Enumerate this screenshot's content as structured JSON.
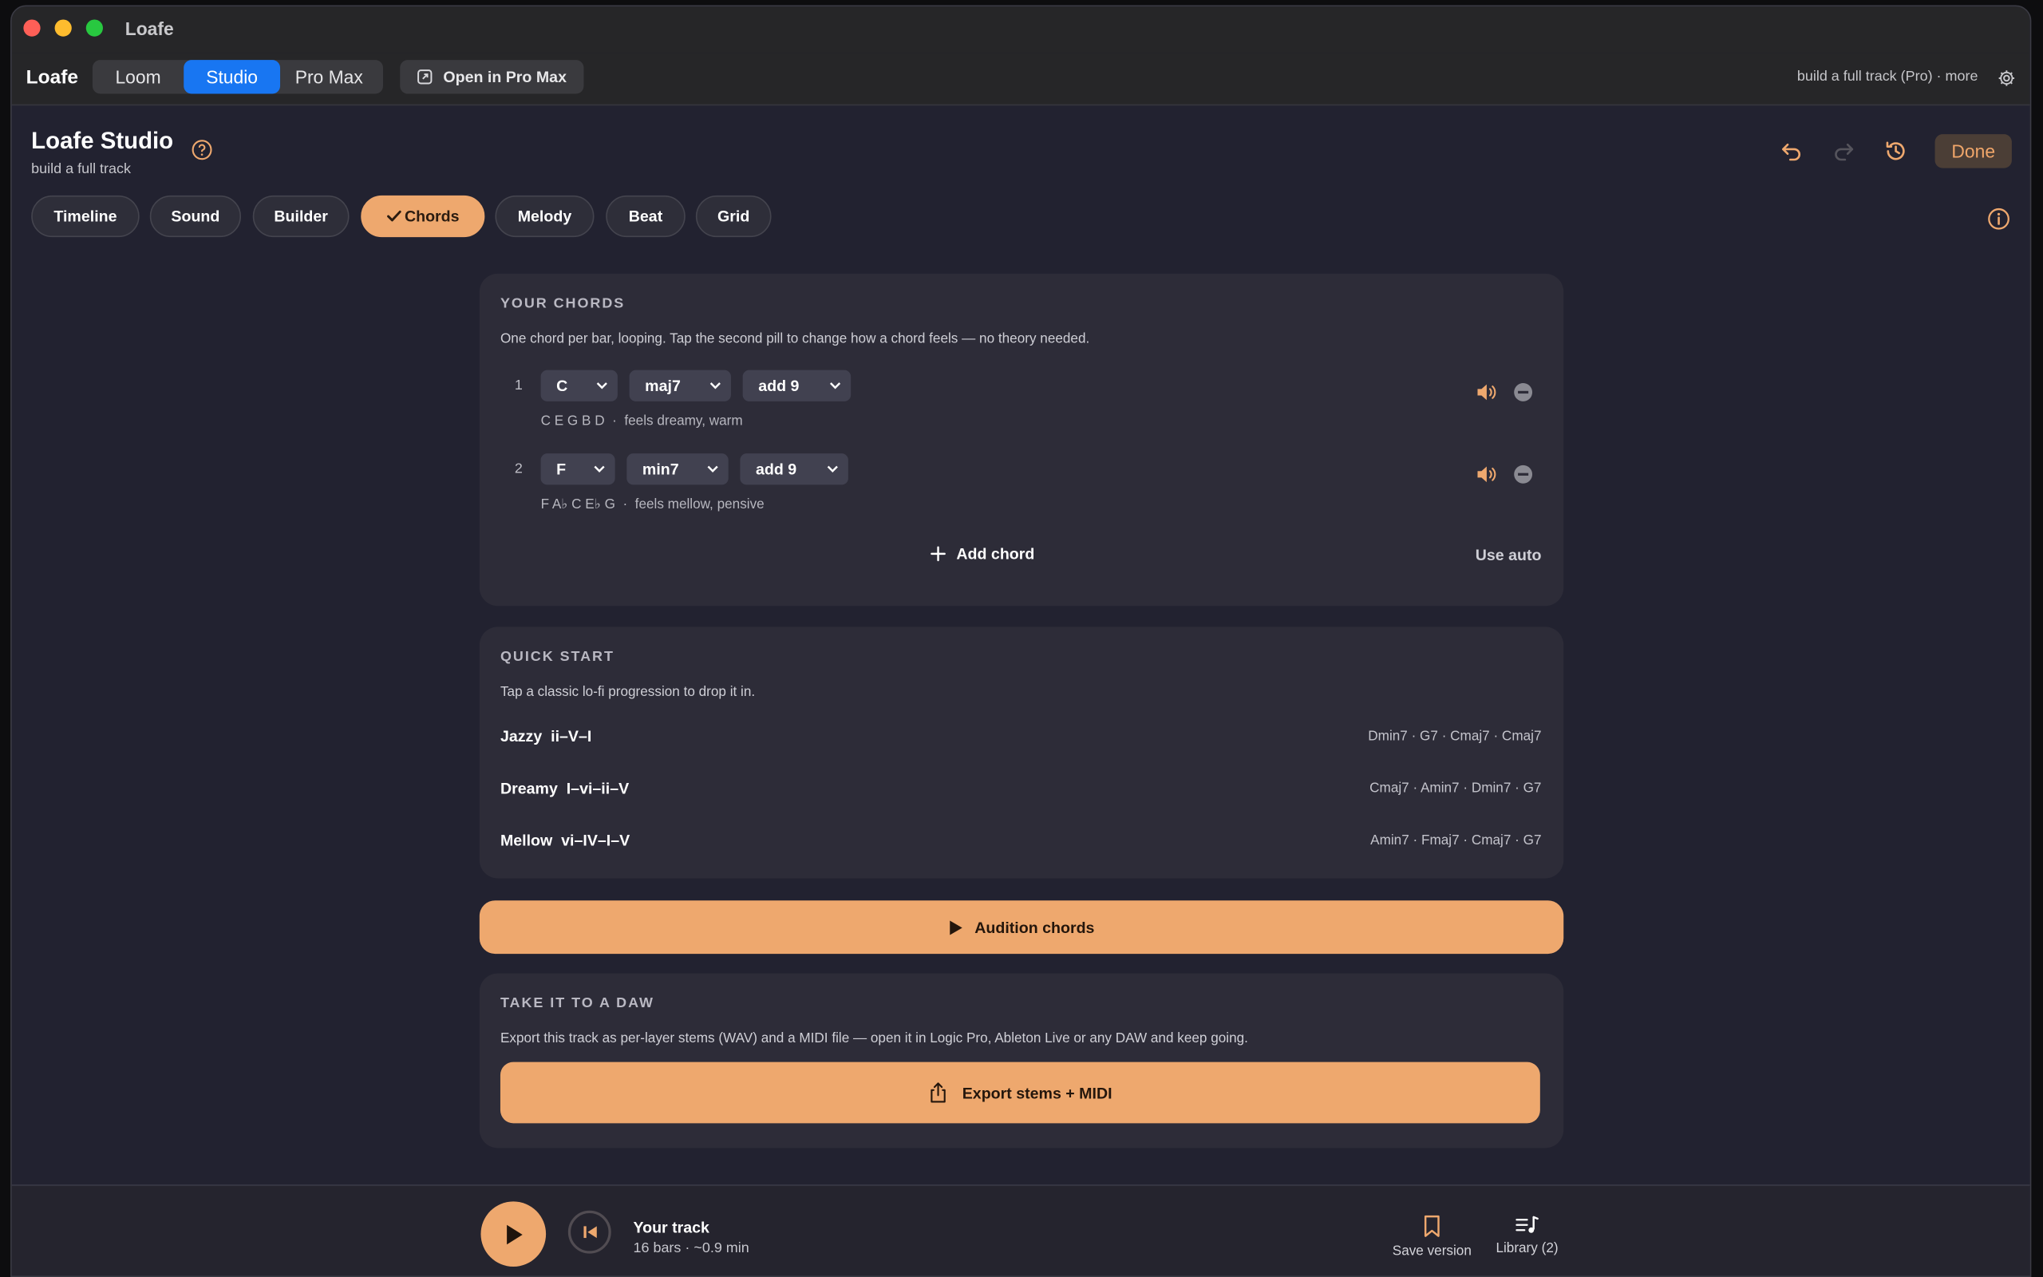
{
  "window": {
    "title": "Loafe"
  },
  "appbar": {
    "brand": "Loafe",
    "modes": [
      "Loom",
      "Studio",
      "Pro Max"
    ],
    "active_mode": "Studio",
    "open_button": "Open in Pro Max",
    "right_text": "build a full track (Pro) · more"
  },
  "header": {
    "title": "Loafe Studio",
    "subtitle": "build a full track",
    "done": "Done"
  },
  "tabs": [
    "Timeline",
    "Sound",
    "Builder",
    "Chords",
    "Melody",
    "Beat",
    "Grid"
  ],
  "active_tab": "Chords",
  "your_chords": {
    "title": "YOUR CHORDS",
    "description": "One chord per bar, looping. Tap the second pill to change how a chord feels — no theory needed.",
    "rows": [
      {
        "num": "1",
        "root": "C",
        "quality": "maj7",
        "extension": "add 9",
        "notes": "C E G B D",
        "feel": "feels dreamy, warm"
      },
      {
        "num": "2",
        "root": "F",
        "quality": "min7",
        "extension": "add 9",
        "notes": "F A♭ C E♭ G",
        "feel": "feels mellow, pensive"
      }
    ],
    "add_chord": "Add chord",
    "use_auto": "Use auto"
  },
  "quick_start": {
    "title": "QUICK START",
    "description": "Tap a classic lo-fi progression to drop it in.",
    "items": [
      {
        "name": "Jazzy  ii–V–I",
        "chords": "Dmin7 · G7 · Cmaj7 · Cmaj7"
      },
      {
        "name": "Dreamy  I–vi–ii–V",
        "chords": "Cmaj7 · Amin7 · Dmin7 · G7"
      },
      {
        "name": "Mellow  vi–IV–I–V",
        "chords": "Amin7 · Fmaj7 · Cmaj7 · G7"
      }
    ]
  },
  "audition": "Audition chords",
  "daw": {
    "title": "TAKE IT TO A DAW",
    "description": "Export this track as per-layer stems (WAV) and a MIDI file — open it in Logic Pro, Ableton Live or any DAW and keep going.",
    "export_button": "Export stems + MIDI"
  },
  "player": {
    "title": "Your track",
    "meta": "16 bars · ~0.9 min",
    "save_version": "Save version",
    "library": "Library (2)"
  },
  "colors": {
    "accent": "#eea86e",
    "mode_active": "#1876f2",
    "background": "#222230",
    "card": "#2d2c38"
  }
}
